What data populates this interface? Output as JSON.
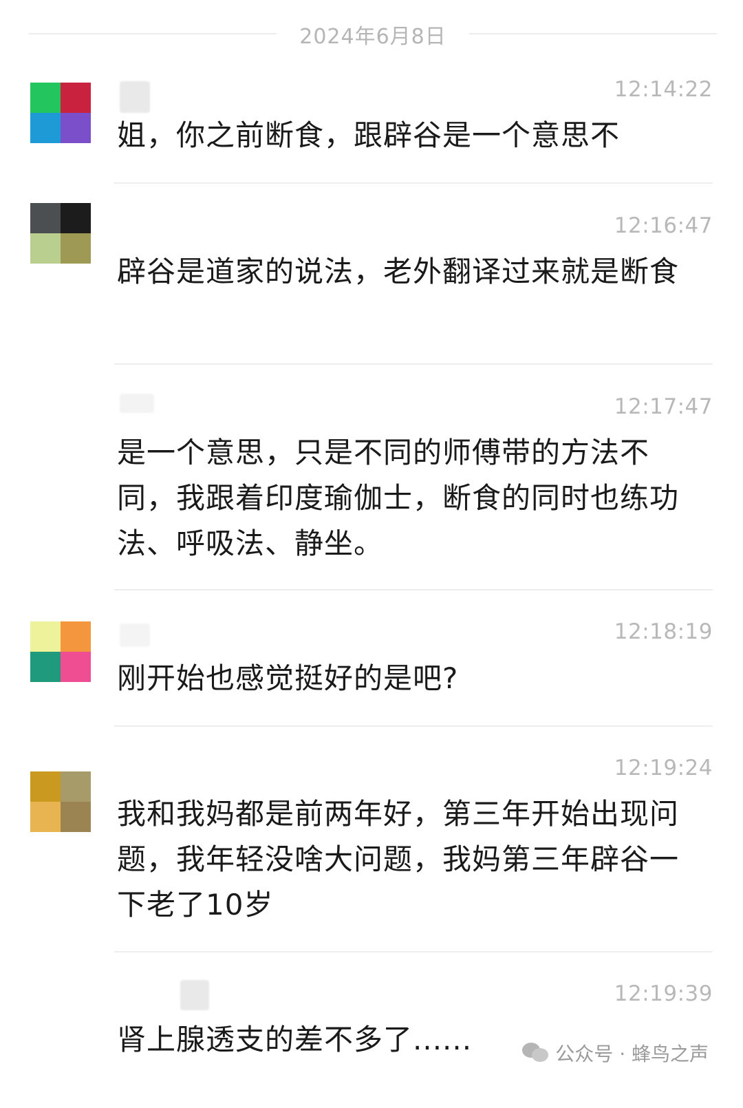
{
  "date_divider": "2024年6月8日",
  "messages": [
    {
      "time": "12:14:22",
      "text": "姐，你之前断食，跟辟谷是一个意思不",
      "avatar_colors": [
        "#22c55e",
        "#c8223f",
        "#1e9bd7",
        "#7a4fc9"
      ]
    },
    {
      "time": "12:16:47",
      "text": "辟谷是道家的说法，老外翻译过来就是断食",
      "avatar_colors": [
        "#4b4f52",
        "#1c1c1c",
        "#b9cf8f",
        "#9e9a56"
      ]
    },
    {
      "time": "12:17:47",
      "text": "是一个意思，只是不同的师傅带的方法不同，我跟着印度瑜伽士，断食的同时也练功法、呼吸法、静坐。"
    },
    {
      "time": "12:18:19",
      "text": "刚开始也感觉挺好的是吧?",
      "avatar_colors": [
        "#eef29a",
        "#f4963e",
        "#1f9a7c",
        "#f04e93"
      ]
    },
    {
      "time": "12:19:24",
      "text": "我和我妈都是前两年好，第三年开始出现问题，我年轻没啥大问题，我妈第三年辟谷一下老了10岁",
      "avatar_colors": [
        "#c99a1f",
        "#a79b6a",
        "#e8b452",
        "#9b8452"
      ]
    },
    {
      "time": "12:19:39",
      "text": "肾上腺透支的差不多了......"
    }
  ],
  "watermark": "公众号 · 蜂鸟之声"
}
